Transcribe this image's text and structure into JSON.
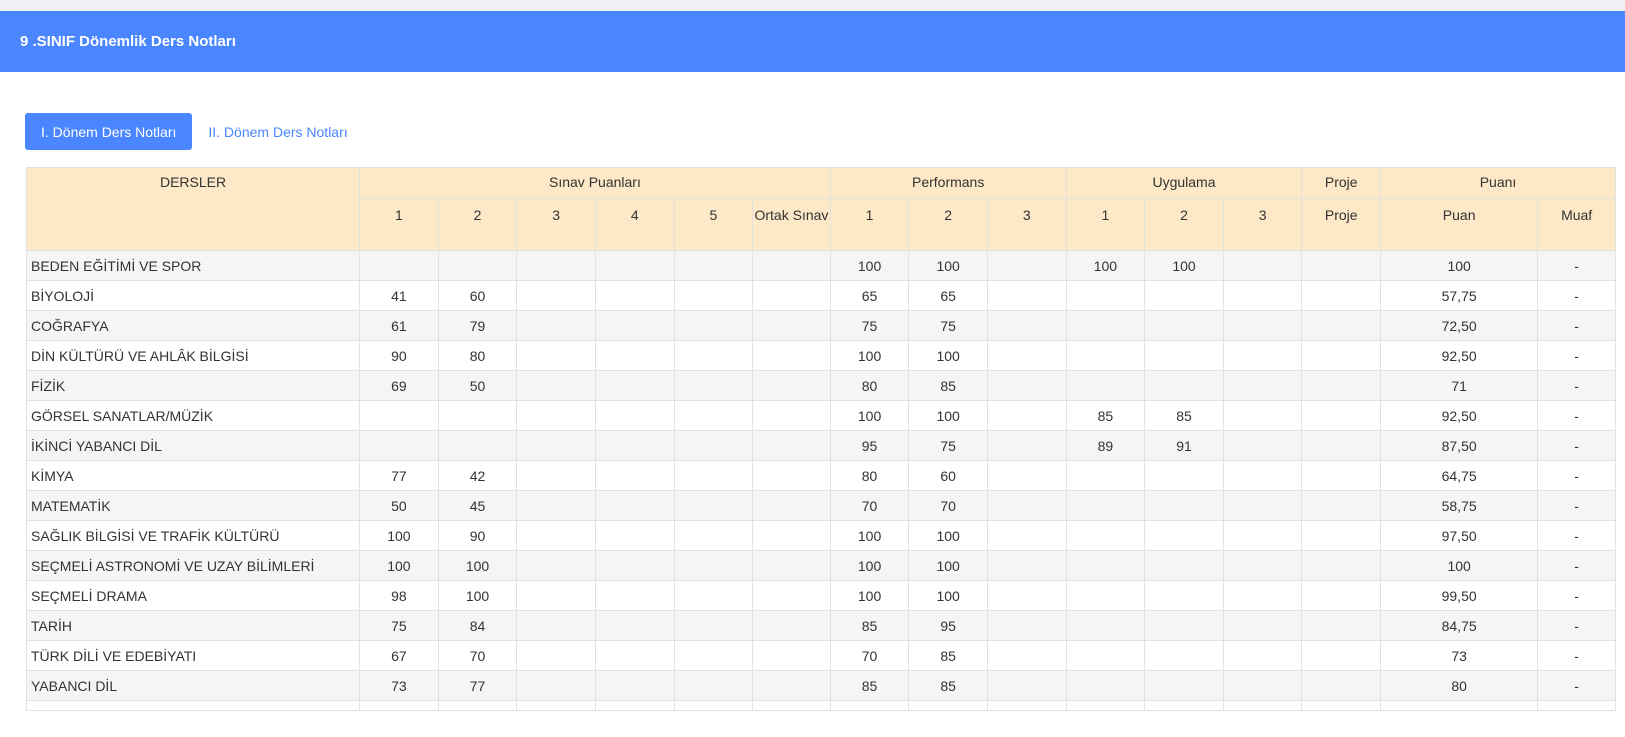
{
  "header": {
    "title": "9 .SINIF Dönemlik Ders Notları"
  },
  "tabs": [
    {
      "label": "I. Dönem Ders Notları",
      "active": true
    },
    {
      "label": "II. Dönem Ders Notları",
      "active": false
    }
  ],
  "table": {
    "groups": {
      "courses": "DERSLER",
      "exam": "Sınav Puanları",
      "performance": "Performans",
      "practice": "Uygulama",
      "project": "Proje",
      "score": "Puanı"
    },
    "sub": {
      "exam": [
        "1",
        "2",
        "3",
        "4",
        "5",
        "Ortak Sınav"
      ],
      "performance": [
        "1",
        "2",
        "3"
      ],
      "practice": [
        "1",
        "2",
        "3"
      ],
      "project": "Proje",
      "score": "Puan",
      "exempt": "Muaf"
    },
    "rows": [
      {
        "name": "BEDEN EĞİTİMİ VE SPOR",
        "cells": [
          "",
          "",
          "",
          "",
          "",
          "",
          "100",
          "100",
          "",
          "100",
          "100",
          "",
          "",
          "100",
          "-"
        ]
      },
      {
        "name": "BİYOLOJİ",
        "cells": [
          "41",
          "60",
          "",
          "",
          "",
          "",
          "65",
          "65",
          "",
          "",
          "",
          "",
          "",
          "57,75",
          "-"
        ]
      },
      {
        "name": "COĞRAFYA",
        "cells": [
          "61",
          "79",
          "",
          "",
          "",
          "",
          "75",
          "75",
          "",
          "",
          "",
          "",
          "",
          "72,50",
          "-"
        ]
      },
      {
        "name": "DİN KÜLTÜRÜ VE AHLÂK BİLGİSİ",
        "cells": [
          "90",
          "80",
          "",
          "",
          "",
          "",
          "100",
          "100",
          "",
          "",
          "",
          "",
          "",
          "92,50",
          "-"
        ]
      },
      {
        "name": "FİZİK",
        "cells": [
          "69",
          "50",
          "",
          "",
          "",
          "",
          "80",
          "85",
          "",
          "",
          "",
          "",
          "",
          "71",
          "-"
        ]
      },
      {
        "name": "GÖRSEL SANATLAR/MÜZİK",
        "cells": [
          "",
          "",
          "",
          "",
          "",
          "",
          "100",
          "100",
          "",
          "85",
          "85",
          "",
          "",
          "92,50",
          "-"
        ]
      },
      {
        "name": "İKİNCİ YABANCI DİL",
        "cells": [
          "",
          "",
          "",
          "",
          "",
          "",
          "95",
          "75",
          "",
          "89",
          "91",
          "",
          "",
          "87,50",
          "-"
        ]
      },
      {
        "name": "KİMYA",
        "cells": [
          "77",
          "42",
          "",
          "",
          "",
          "",
          "80",
          "60",
          "",
          "",
          "",
          "",
          "",
          "64,75",
          "-"
        ]
      },
      {
        "name": "MATEMATİK",
        "cells": [
          "50",
          "45",
          "",
          "",
          "",
          "",
          "70",
          "70",
          "",
          "",
          "",
          "",
          "",
          "58,75",
          "-"
        ]
      },
      {
        "name": "SAĞLIK BİLGİSİ VE TRAFİK KÜLTÜRÜ",
        "cells": [
          "100",
          "90",
          "",
          "",
          "",
          "",
          "100",
          "100",
          "",
          "",
          "",
          "",
          "",
          "97,50",
          "-"
        ]
      },
      {
        "name": "SEÇMELİ ASTRONOMİ VE UZAY BİLİMLERİ",
        "cells": [
          "100",
          "100",
          "",
          "",
          "",
          "",
          "100",
          "100",
          "",
          "",
          "",
          "",
          "",
          "100",
          "-"
        ]
      },
      {
        "name": "SEÇMELİ DRAMA",
        "cells": [
          "98",
          "100",
          "",
          "",
          "",
          "",
          "100",
          "100",
          "",
          "",
          "",
          "",
          "",
          "99,50",
          "-"
        ]
      },
      {
        "name": "TARİH",
        "cells": [
          "75",
          "84",
          "",
          "",
          "",
          "",
          "85",
          "95",
          "",
          "",
          "",
          "",
          "",
          "84,75",
          "-"
        ]
      },
      {
        "name": "TÜRK DİLİ VE EDEBİYATI",
        "cells": [
          "67",
          "70",
          "",
          "",
          "",
          "",
          "70",
          "85",
          "",
          "",
          "",
          "",
          "",
          "73",
          "-"
        ]
      },
      {
        "name": "YABANCI DİL",
        "cells": [
          "73",
          "77",
          "",
          "",
          "",
          "",
          "85",
          "85",
          "",
          "",
          "",
          "",
          "",
          "80",
          "-"
        ]
      }
    ]
  }
}
